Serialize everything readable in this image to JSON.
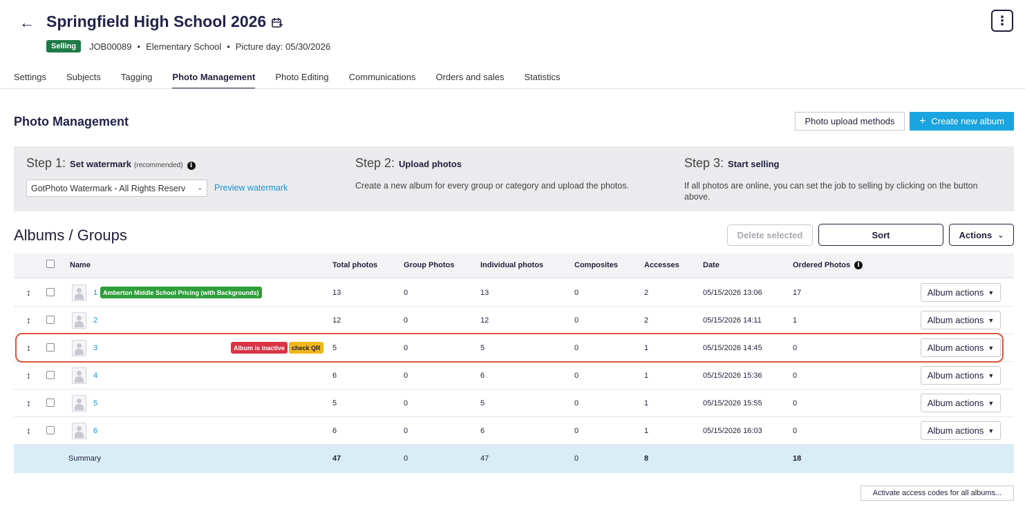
{
  "header": {
    "title": "Springfield High School 2026",
    "status_badge": "Selling",
    "job_id": "JOB00089",
    "sep": "•",
    "school_type": "Elementary School",
    "picture_day": "Picture day: 05/30/2026",
    "back_icon": "arrow-left-icon",
    "calendar_icon": "calendar-icon",
    "menu_icon": "kebab-menu-icon",
    "status_color": "#1e7a47"
  },
  "tabs": [
    {
      "label": "Settings"
    },
    {
      "label": "Subjects"
    },
    {
      "label": "Tagging"
    },
    {
      "label": "Photo Management",
      "active": true
    },
    {
      "label": "Photo Editing"
    },
    {
      "label": "Communications"
    },
    {
      "label": "Orders and sales"
    },
    {
      "label": "Statistics"
    }
  ],
  "section": {
    "title": "Photo Management",
    "upload_methods": "Photo upload methods",
    "create_album": "Create new album",
    "accent_color": "#1aa4e0"
  },
  "steps": {
    "step1": {
      "prefix": "Step 1:",
      "title": "Set watermark",
      "note": "(recommended)",
      "select_value": "GotPhoto Watermark - All Rights Reserv",
      "preview_link": "Preview watermark"
    },
    "step2": {
      "prefix": "Step 2:",
      "title": "Upload photos",
      "text": "Create a new album for every group or category and upload the photos."
    },
    "step3": {
      "prefix": "Step 3:",
      "title": "Start selling",
      "text": "If all photos are online, you can set the job to selling by clicking on the button above."
    }
  },
  "albums": {
    "title": "Albums / Groups",
    "delete_selected": "Delete selected",
    "sort": "Sort",
    "actions": "Actions",
    "columns": {
      "name": "Name",
      "total": "Total photos",
      "group": "Group Photos",
      "individual": "Individual photos",
      "composites": "Composites",
      "accesses": "Accesses",
      "date": "Date",
      "ordered": "Ordered Photos"
    },
    "row_action_label": "Album actions",
    "rows": [
      {
        "name": "1",
        "tag": "Amberton Middle School Pricing (with Backgrounds)",
        "total": "13",
        "group": "0",
        "individual": "13",
        "composites": "0",
        "accesses": "2",
        "date": "05/15/2026 13:06",
        "ordered": "17"
      },
      {
        "name": "2",
        "total": "12",
        "group": "0",
        "individual": "12",
        "composites": "0",
        "accesses": "2",
        "date": "05/15/2026 14:11",
        "ordered": "1"
      },
      {
        "name": "3",
        "inactive_tag": "Album is inactive",
        "qr_tag": "check QR",
        "total": "5",
        "group": "0",
        "individual": "5",
        "composites": "0",
        "accesses": "1",
        "date": "05/15/2026 14:45",
        "ordered": "0"
      },
      {
        "name": "4",
        "total": "6",
        "group": "0",
        "individual": "6",
        "composites": "0",
        "accesses": "1",
        "date": "05/15/2026 15:36",
        "ordered": "0"
      },
      {
        "name": "5",
        "total": "5",
        "group": "0",
        "individual": "5",
        "composites": "0",
        "accesses": "1",
        "date": "05/15/2026 15:55",
        "ordered": "0"
      },
      {
        "name": "6",
        "total": "6",
        "group": "0",
        "individual": "6",
        "composites": "0",
        "accesses": "1",
        "date": "05/15/2026 16:03",
        "ordered": "0"
      }
    ],
    "summary": {
      "label": "Summary",
      "total": "47",
      "group": "0",
      "individual": "47",
      "composites": "0",
      "accesses": "8",
      "ordered": "18"
    },
    "activate_codes": "Activate access codes for all albums..."
  }
}
